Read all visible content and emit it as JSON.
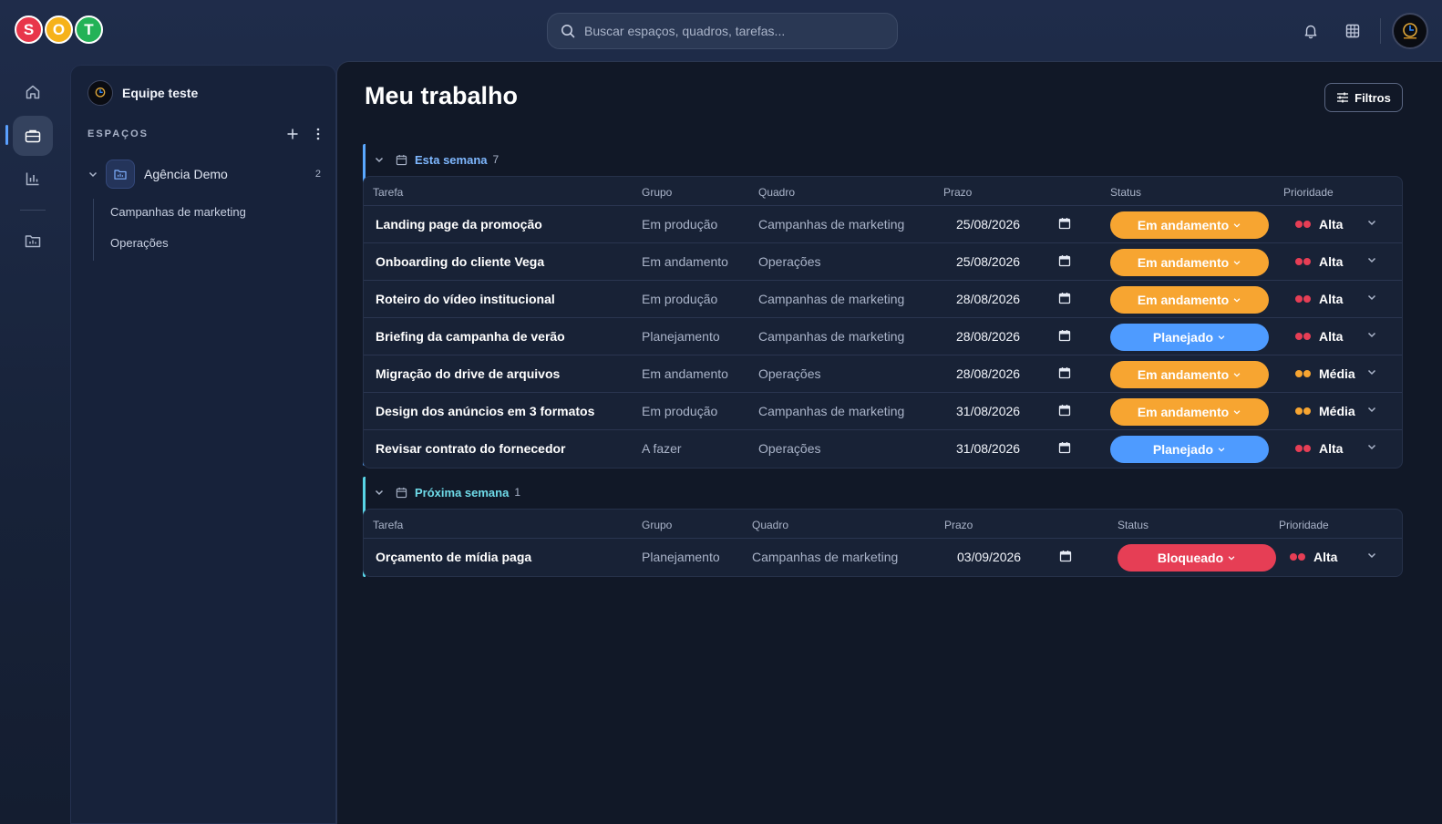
{
  "brand": {
    "letters": [
      "S",
      "O",
      "T"
    ]
  },
  "search": {
    "placeholder": "Buscar espaços, quadros, tarefas..."
  },
  "icons": {
    "topbar": [
      "bell-icon",
      "grid-icon"
    ],
    "rail": [
      "home-icon",
      "briefcase-icon",
      "bar-chart-icon",
      "folder-chart-icon"
    ]
  },
  "sidebar": {
    "team_name": "Equipe teste",
    "spaces_label": "ESPAÇOS",
    "space": {
      "name": "Agência Demo",
      "count": "2"
    },
    "boards": [
      "Campanhas de marketing",
      "Operações"
    ]
  },
  "main": {
    "title": "Meu trabalho",
    "filters_label": "Filtros"
  },
  "columns": {
    "task": "Tarefa",
    "group": "Grupo",
    "board": "Quadro",
    "due": "Prazo",
    "status": "Status",
    "priority": "Prioridade"
  },
  "colors": {
    "accent_week": "#5aa8ff",
    "accent_next": "#58d4e6",
    "status_em_andamento": "#f7a531",
    "status_planejado": "#4e9bff",
    "status_bloqueado": "#e63e55",
    "prio_alta": "#e63e55",
    "prio_media": "#f7a531"
  },
  "groups": [
    {
      "title": "Esta semana",
      "count": "7",
      "rows": [
        {
          "task": "Landing page da promoção",
          "group": "Em produção",
          "board": "Campanhas de marketing",
          "due": "25/08/2026",
          "status": "Em andamento",
          "priority": "Alta"
        },
        {
          "task": "Onboarding do cliente Vega",
          "group": "Em andamento",
          "board": "Operações",
          "due": "25/08/2026",
          "status": "Em andamento",
          "priority": "Alta"
        },
        {
          "task": "Roteiro do vídeo institucional",
          "group": "Em produção",
          "board": "Campanhas de marketing",
          "due": "28/08/2026",
          "status": "Em andamento",
          "priority": "Alta"
        },
        {
          "task": "Briefing da campanha de verão",
          "group": "Planejamento",
          "board": "Campanhas de marketing",
          "due": "28/08/2026",
          "status": "Planejado",
          "priority": "Alta"
        },
        {
          "task": "Migração do drive de arquivos",
          "group": "Em andamento",
          "board": "Operações",
          "due": "28/08/2026",
          "status": "Em andamento",
          "priority": "Média"
        },
        {
          "task": "Design dos anúncios em 3 formatos",
          "group": "Em produção",
          "board": "Campanhas de marketing",
          "due": "31/08/2026",
          "status": "Em andamento",
          "priority": "Média"
        },
        {
          "task": "Revisar contrato do fornecedor",
          "group": "A fazer",
          "board": "Operações",
          "due": "31/08/2026",
          "status": "Planejado",
          "priority": "Alta"
        }
      ]
    },
    {
      "title": "Próxima semana",
      "count": "1",
      "rows": [
        {
          "task": "Orçamento de mídia paga",
          "group": "Planejamento",
          "board": "Campanhas de marketing",
          "due": "03/09/2026",
          "status": "Bloqueado",
          "priority": "Alta"
        }
      ]
    }
  ]
}
